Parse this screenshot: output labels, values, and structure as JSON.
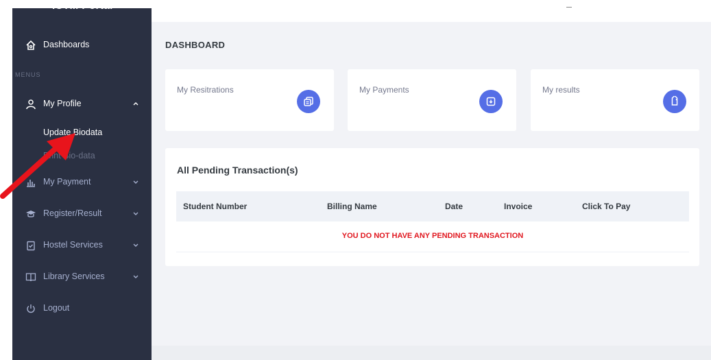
{
  "brand": {
    "title": "ICTM Portal"
  },
  "sidebar": {
    "dashboard_label": "Dashboards",
    "menus_title": "MENUS",
    "items": [
      {
        "label": "My Profile",
        "icon": "user-icon",
        "expanded": true
      },
      {
        "label": "My Payment",
        "icon": "bar-chart-icon"
      },
      {
        "label": "Register/Result",
        "icon": "graduation-cap-icon"
      },
      {
        "label": "Hostel Services",
        "icon": "clipboard-check-icon"
      },
      {
        "label": "Library Services",
        "icon": "book-icon"
      },
      {
        "label": "Logout",
        "icon": "power-icon"
      }
    ],
    "submenu": [
      {
        "label": "Update Biodata"
      },
      {
        "label": "Print Bio-data"
      }
    ]
  },
  "main": {
    "page_title": "DASHBOARD",
    "cards": [
      {
        "title": "My Resitrations",
        "icon": "copy-icon"
      },
      {
        "title": "My Payments",
        "icon": "archive-icon"
      },
      {
        "title": "My results",
        "icon": "tag-icon"
      }
    ],
    "panel": {
      "title": "All Pending Transaction(s)",
      "columns": [
        "Student Number",
        "Billing Name",
        "Date",
        "Invoice",
        "Click To Pay"
      ],
      "empty_message": "YOU DO NOT HAVE ANY PENDING TRANSACTION"
    }
  },
  "colors": {
    "sidebar_bg": "#2a3042",
    "accent": "#556ee6",
    "error": "#e0161e",
    "annotation_arrow": "#e8141c"
  }
}
